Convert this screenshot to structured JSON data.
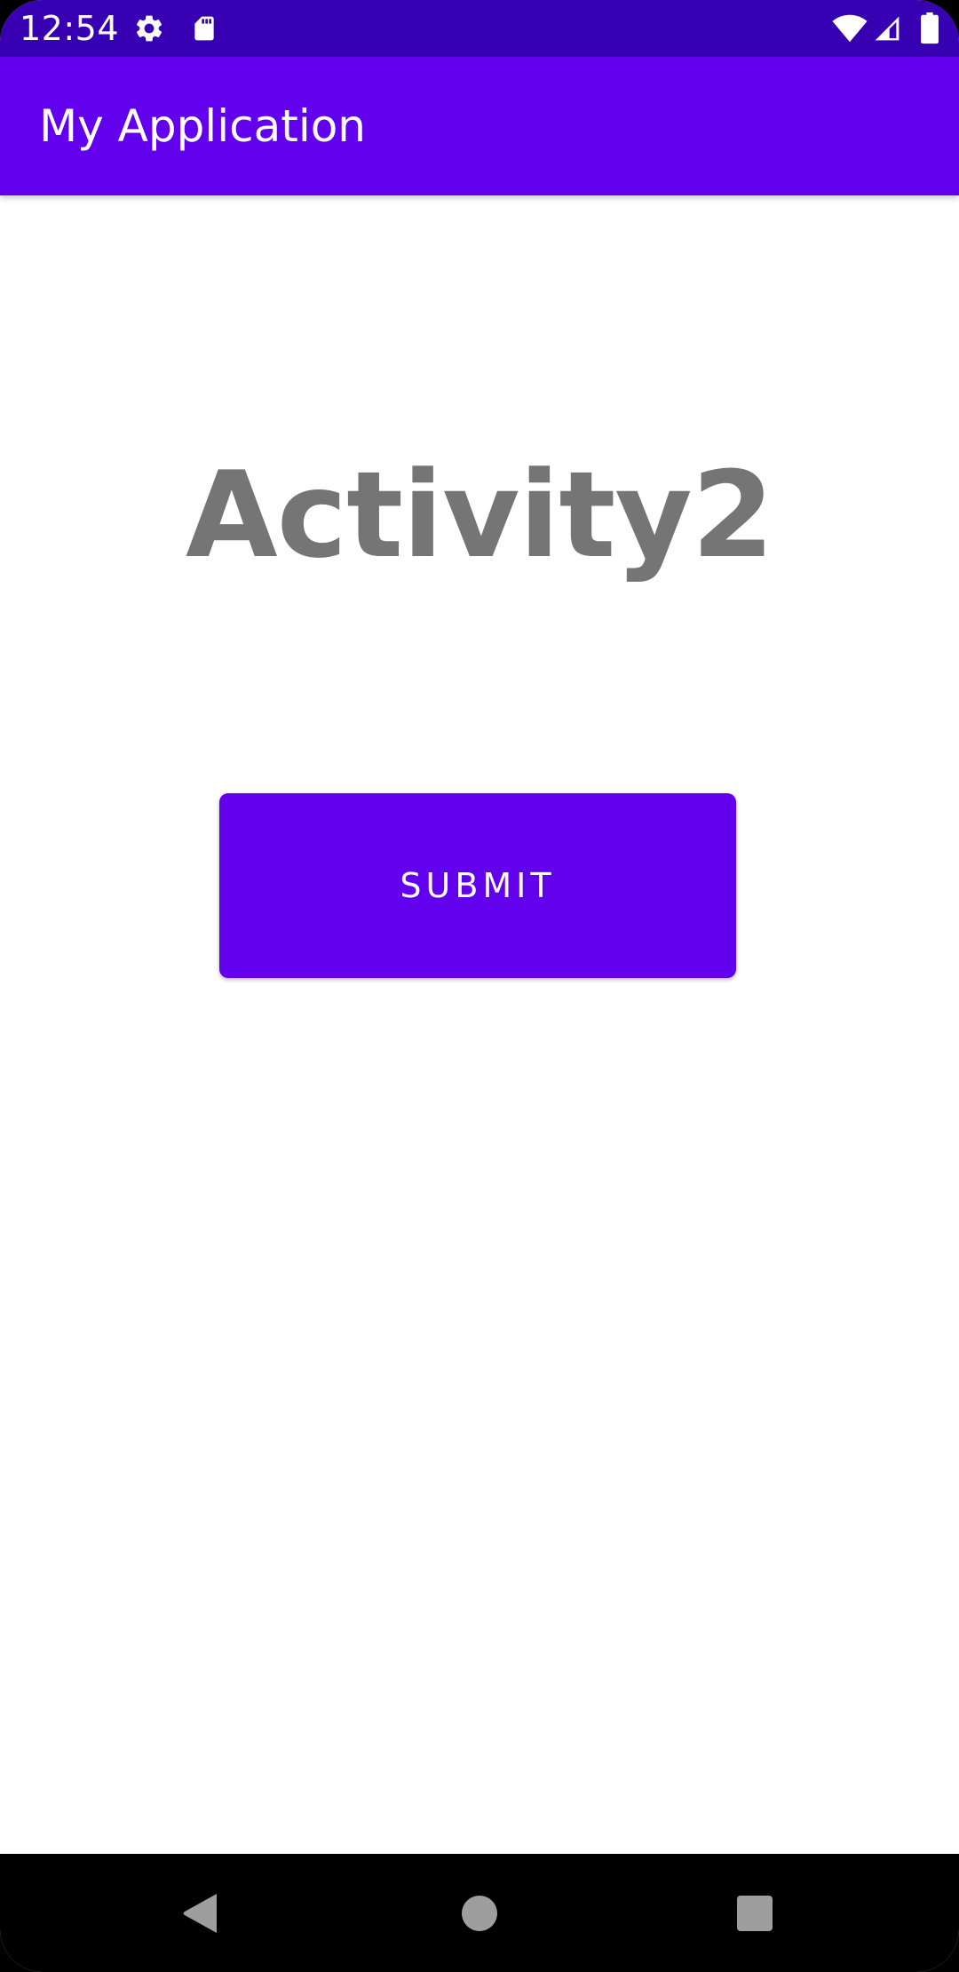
{
  "status_bar": {
    "time": "12:54",
    "icons": [
      "gear-icon",
      "sd-card-icon",
      "wifi-icon",
      "signal-icon",
      "battery-icon"
    ],
    "background": "#3700B3"
  },
  "app_bar": {
    "title": "My Application",
    "background": "#6200EE"
  },
  "main": {
    "heading": "Activity2",
    "heading_color": "#757575",
    "submit_label": "SUBMIT",
    "button_color": "#6200EE"
  },
  "nav_bar": {
    "buttons": [
      "back-icon",
      "home-icon",
      "recents-icon"
    ]
  }
}
